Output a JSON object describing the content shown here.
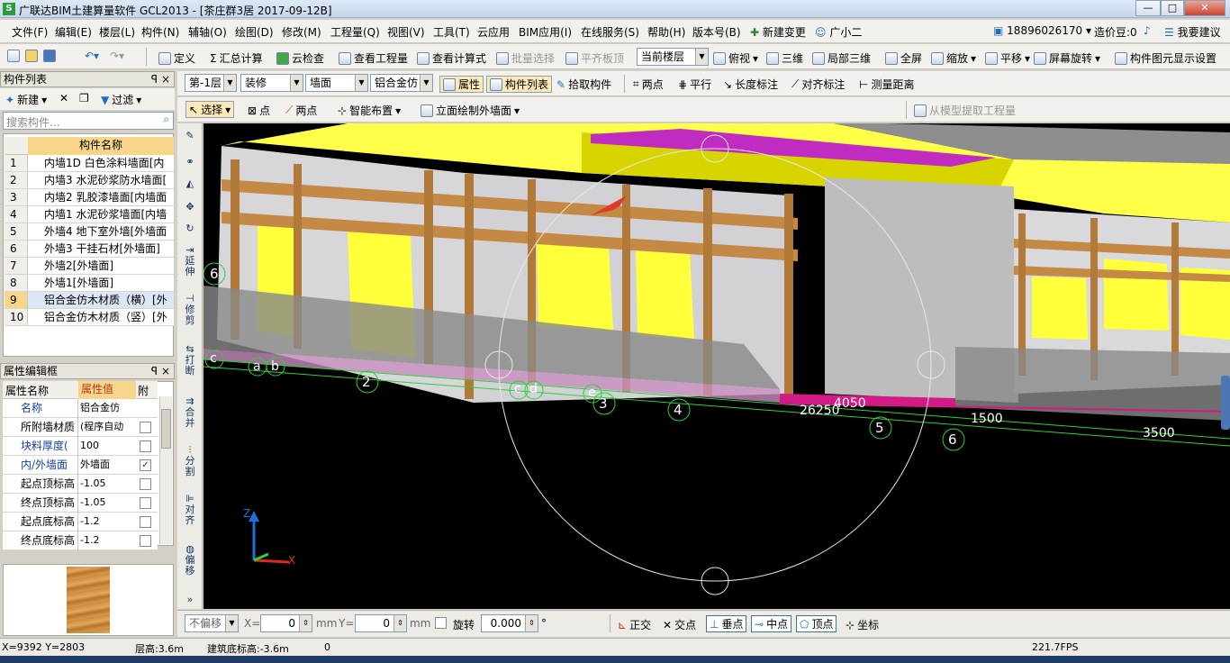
{
  "window": {
    "title": "广联达BIM土建算量软件 GCL2013 - [茶庄群3居 2017-09-12B]",
    "app_icon": "S",
    "min": "—",
    "max": "□",
    "close": "✕"
  },
  "menu": [
    "文件(F)",
    "编辑(E)",
    "楼层(L)",
    "构件(N)",
    "辅轴(O)",
    "绘图(D)",
    "修改(M)",
    "工程量(Q)",
    "视图(V)",
    "工具(T)",
    "云应用",
    "BIM应用(I)",
    "在线服务(S)",
    "帮助(H)",
    "版本号(B)",
    "新建变更",
    "广小二"
  ],
  "account": {
    "phone": "18896026170",
    "coin": "造价豆:0",
    "suggest": "我要建议"
  },
  "toolbar1": {
    "define": "定义",
    "sum": "汇总计算",
    "cloud_check": "云检查",
    "view_qty": "查看工程量",
    "view_formula": "查看计算式",
    "batch_select": "批量选择",
    "flat_slab": "平齐板顶",
    "floor_combo": "当前楼层",
    "top_view": "俯视",
    "three_d": "三维",
    "local_3d": "局部三维",
    "fullscreen": "全屏",
    "zoom": "缩放",
    "pan": "平移",
    "rotate": "屏幕旋转",
    "display_settings": "构件图元显示设置"
  },
  "toolbar2": {
    "floor": "第-1层",
    "category": "装修",
    "type": "墙面",
    "member": "铝合金仿",
    "property": "属性",
    "member_list": "构件列表",
    "pick": "拾取构件",
    "two_points": "两点",
    "parallel": "平行",
    "dimension": "长度标注",
    "align_dim": "对齐标注",
    "measure": "测量距离"
  },
  "toolbar3": {
    "select": "选择",
    "point": "点",
    "two_points": "两点",
    "smart_layout": "智能布置",
    "elevation_draw": "立面绘制外墙面",
    "extract_qty": "从模型提取工程量"
  },
  "member_panel": {
    "title": "构件列表",
    "new": "新建",
    "filter": "过滤",
    "search_placeholder": "搜索构件...",
    "header": "构件名称",
    "rows": [
      {
        "n": "1",
        "name": "内墙1D 白色涂料墙面[内"
      },
      {
        "n": "2",
        "name": "内墙3 水泥砂浆防水墙面["
      },
      {
        "n": "3",
        "name": "内墙2 乳胶漆墙面[内墙面"
      },
      {
        "n": "4",
        "name": "内墙1 水泥砂浆墙面[内墙"
      },
      {
        "n": "5",
        "name": "外墙4 地下室外墙[外墙面"
      },
      {
        "n": "6",
        "name": "外墙3 干挂石材[外墙面]"
      },
      {
        "n": "7",
        "name": "外墙2[外墙面]"
      },
      {
        "n": "8",
        "name": "外墙1[外墙面]"
      },
      {
        "n": "9",
        "name": "铝合金仿木材质（横）[外"
      },
      {
        "n": "10",
        "name": "铝合金仿木材质（竖）[外"
      }
    ]
  },
  "prop_panel": {
    "title": "属性编辑框",
    "col_name": "属性名称",
    "col_value": "属性值",
    "col_extra": "附加",
    "rows": [
      {
        "name": "名称",
        "value": "铝合金仿",
        "check": ""
      },
      {
        "name": "所附墙材质",
        "value": "(程序自动",
        "check": ""
      },
      {
        "name": "块料厚度(",
        "value": "100",
        "check": ""
      },
      {
        "name": "内/外墙面",
        "value": "外墙面",
        "check": "✓"
      },
      {
        "name": "起点顶标高",
        "value": "-1.05",
        "check": ""
      },
      {
        "name": "终点顶标高",
        "value": "-1.05",
        "check": ""
      },
      {
        "name": "起点底标高",
        "value": "-1.2",
        "check": ""
      },
      {
        "name": "终点底标高",
        "value": "-1.2",
        "check": ""
      }
    ]
  },
  "vtools": [
    "延伸",
    "修剪",
    "打断",
    "合并",
    "分割",
    "对齐",
    "偏移"
  ],
  "canvas": {
    "axes": [
      "2",
      "3",
      "4",
      "5",
      "6",
      "6"
    ],
    "letters": [
      "a",
      "b",
      "c",
      "d",
      "e",
      "c"
    ],
    "dims": [
      "4050",
      "26250",
      "1500",
      "3500"
    ],
    "axis_labels": {
      "z": "Z",
      "x": "X"
    }
  },
  "bottom_bar": {
    "offset": "不偏移",
    "x_label": "X=",
    "x_val": "0",
    "unit": "mm",
    "y_label": "Y=",
    "y_val": "0",
    "rotate": "旋转",
    "rotate_val": "0.000",
    "degree": "°",
    "ortho": "正交",
    "intersect": "交点",
    "perp": "垂点",
    "mid": "中点",
    "vertex": "顶点",
    "coord": "坐标"
  },
  "status": {
    "coords": "X=9392 Y=2803",
    "floor_height": "层高:3.6m",
    "base_elev": "建筑底标高:-3.6m",
    "zero": "0",
    "fps": "221.7FPS"
  }
}
